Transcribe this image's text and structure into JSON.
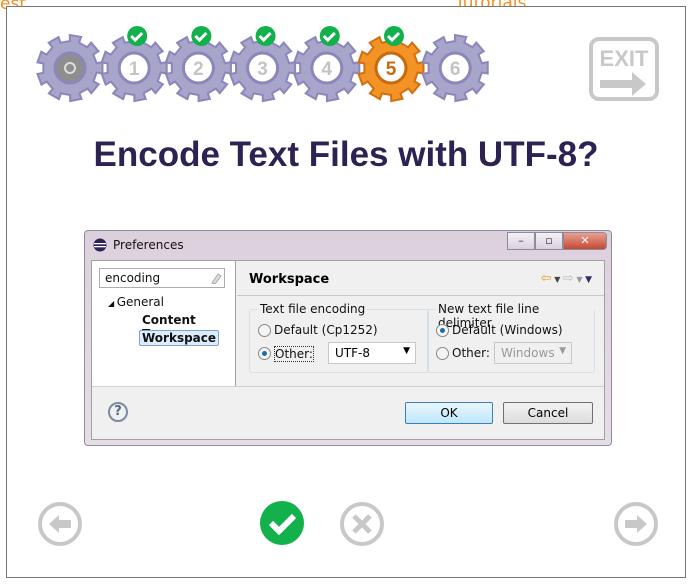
{
  "background": {
    "left_text": "est",
    "right_text": "Tutorials"
  },
  "steps": [
    {
      "label": "",
      "state": "intro",
      "checked": false
    },
    {
      "label": "1",
      "state": "done",
      "checked": true
    },
    {
      "label": "2",
      "state": "done",
      "checked": true
    },
    {
      "label": "3",
      "state": "done",
      "checked": true
    },
    {
      "label": "4",
      "state": "done",
      "checked": true
    },
    {
      "label": "5",
      "state": "current",
      "checked": true
    },
    {
      "label": "6",
      "state": "pending",
      "checked": false
    }
  ],
  "exit_label": "EXIT",
  "title": "Encode Text Files with UTF-8?",
  "dialog": {
    "title": "Preferences",
    "search_value": "encoding",
    "tree": {
      "parent": "General",
      "children": [
        "Content Types",
        "Workspace"
      ],
      "selected": "Workspace"
    },
    "page_title": "Workspace",
    "encoding_group": {
      "label": "Text file encoding",
      "default_label": "Default (Cp1252)",
      "other_label": "Other:",
      "value": "UTF-8",
      "selected": "other"
    },
    "delimiter_group": {
      "label": "New text file line delimiter",
      "default_label": "Default (Windows)",
      "other_label": "Other:",
      "value": "Windows",
      "selected": "default"
    },
    "ok_label": "OK",
    "cancel_label": "Cancel"
  },
  "colors": {
    "gear": "#a7a5c9",
    "gear_current": "#f39325",
    "check": "#12b14b",
    "title": "#2e2252"
  }
}
